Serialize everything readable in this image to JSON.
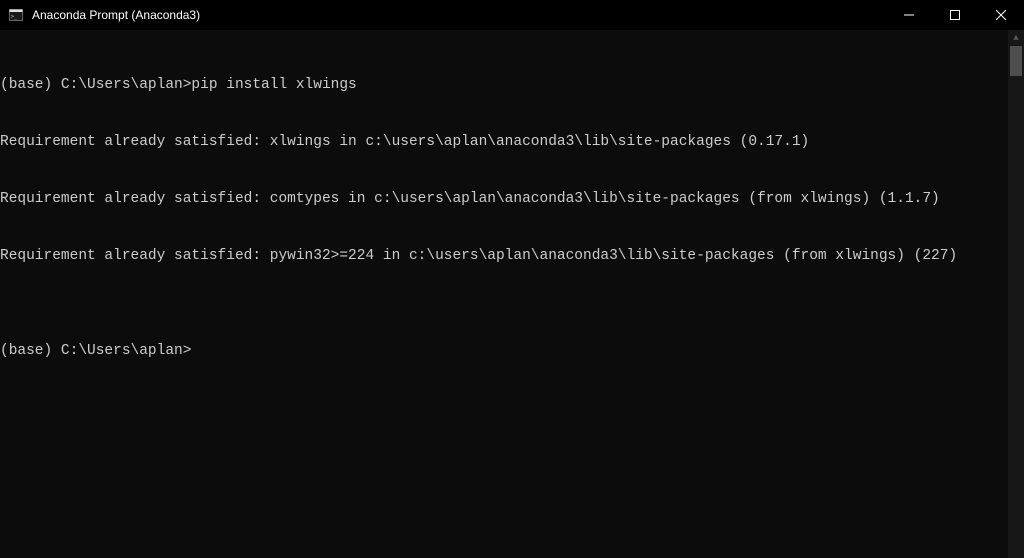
{
  "window": {
    "title": "Anaconda Prompt (Anaconda3)"
  },
  "terminal": {
    "lines": [
      "(base) C:\\Users\\aplan>pip install xlwings",
      "Requirement already satisfied: xlwings in c:\\users\\aplan\\anaconda3\\lib\\site-packages (0.17.1)",
      "Requirement already satisfied: comtypes in c:\\users\\aplan\\anaconda3\\lib\\site-packages (from xlwings) (1.1.7)",
      "Requirement already satisfied: pywin32>=224 in c:\\users\\aplan\\anaconda3\\lib\\site-packages (from xlwings) (227)",
      "",
      "(base) C:\\Users\\aplan>"
    ]
  }
}
